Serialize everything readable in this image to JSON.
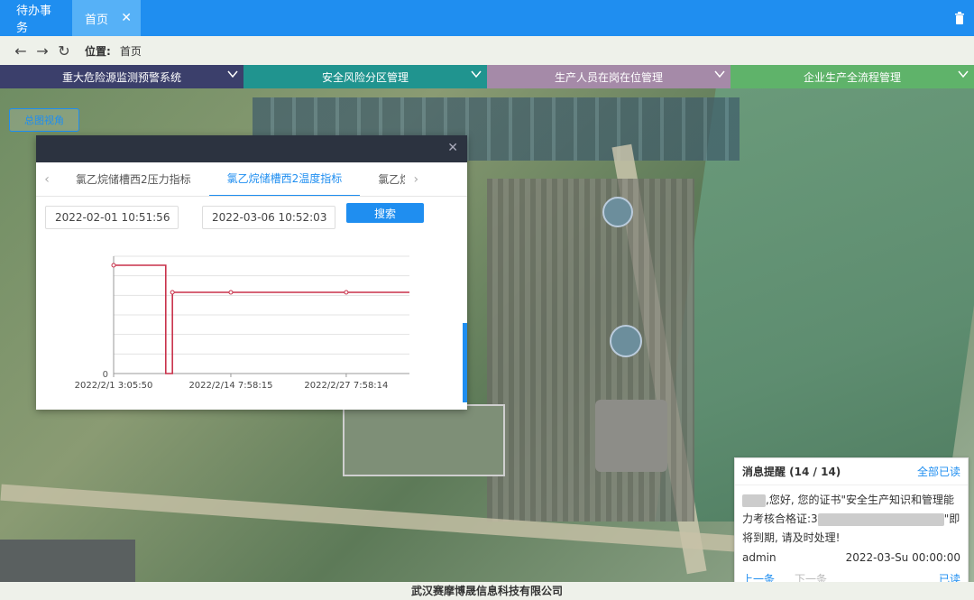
{
  "top_tabs": [
    {
      "label": "待办事务"
    },
    {
      "label": "首页",
      "active": true
    }
  ],
  "address": {
    "label": "位置:",
    "value": "首页"
  },
  "menus": [
    {
      "label": "重大危险源监测预警系统",
      "color": "#3b3f6b"
    },
    {
      "label": "安全风险分区管理",
      "color": "#20948f"
    },
    {
      "label": "生产人员在岗在位管理",
      "color": "#a58aa8"
    },
    {
      "label": "企业生产全流程管理",
      "color": "#5fb36a"
    }
  ],
  "map_button": "总图视角",
  "panel": {
    "tabs": [
      "氯乙烷储槽西2压力指标",
      "氯乙烷储槽西2温度指标",
      "氯乙烷"
    ],
    "active_tab": 1,
    "start_time": "2022-02-01 10:51:56",
    "end_time": "2022-03-06 10:52:03",
    "search_label": "搜索"
  },
  "chart_data": {
    "type": "line",
    "x_tick_labels": [
      "2022/2/1 3:05:50",
      "2022/2/14 7:58:15",
      "2022/2/27 7:58:14"
    ],
    "y_tick_labels": [
      "0",
      "",
      "",
      "",
      "",
      "",
      ""
    ],
    "series": [
      {
        "color": "#c8314a",
        "points": [
          {
            "x": "2022/2/1 3:05:50",
            "y": 6
          },
          {
            "x": "2022/2/7",
            "y": 6
          },
          {
            "x": "2022/2/7",
            "y": 0
          },
          {
            "x": "2022/2/7 18:00",
            "y": 0
          },
          {
            "x": "2022/2/7 18:00",
            "y": 4.5
          },
          {
            "x": "2022/2/14 7:58:15",
            "y": 4.5
          },
          {
            "x": "2022/2/27 7:58:14",
            "y": 4.5
          },
          {
            "x": "2022/3/6 10:52:03",
            "y": 4.5
          }
        ]
      }
    ],
    "ylim": [
      0,
      6.5
    ],
    "grid": true
  },
  "notification": {
    "title": "消息提醒 (14 / 14)",
    "mark_all": "全部已读",
    "body_suffix": ",您好, 您的证书\"安全生产知识和管理能力考核合格证:3",
    "body_end": "\"即将到期, 请及时处理!",
    "user": "admin",
    "time": "2022-03-Su 00:00:00",
    "prev": "上一条",
    "next": "下一条",
    "read": "已读"
  },
  "footer": "武汉赛摩博晟信息科技有限公司"
}
